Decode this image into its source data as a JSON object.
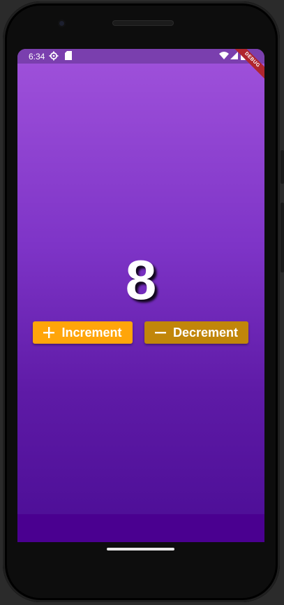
{
  "status_bar": {
    "time": "6:34",
    "icons": [
      "settings-gear-icon",
      "sd-card-icon",
      "wifi-icon",
      "cell-signal-icon",
      "battery-icon"
    ],
    "debug_label": "DEBUG"
  },
  "counter": {
    "value": "8"
  },
  "buttons": {
    "increment": {
      "label": "Increment",
      "icon": "plus-icon",
      "color": "#ffa50a"
    },
    "decrement": {
      "label": "Decrement",
      "icon": "minus-icon",
      "color": "#c1860a"
    }
  },
  "colors": {
    "background_top": "#a052db",
    "background_bottom": "#4b0d95",
    "status_bar": "#7a3fae",
    "bottom_bar": "#4a0090"
  }
}
